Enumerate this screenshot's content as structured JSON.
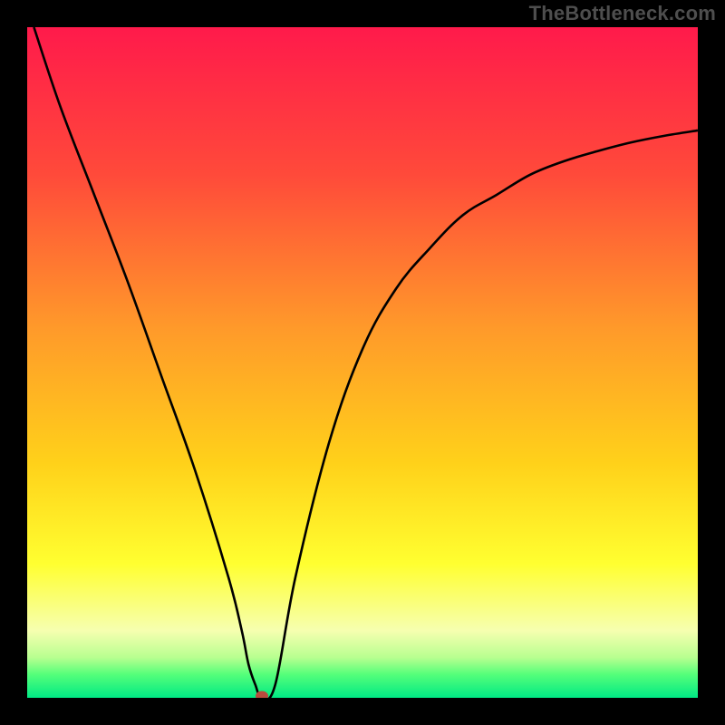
{
  "watermark": "TheBottleneck.com",
  "chart_data": {
    "type": "line",
    "title": "",
    "xlabel": "",
    "ylabel": "",
    "xlim": [
      0,
      100
    ],
    "ylim": [
      0,
      100
    ],
    "grid": false,
    "series": [
      {
        "name": "curve",
        "x": [
          1,
          5,
          10,
          15,
          20,
          25,
          30,
          32,
          33,
          34,
          35,
          37,
          40,
          45,
          50,
          55,
          60,
          65,
          70,
          75,
          80,
          85,
          90,
          95,
          100
        ],
        "y": [
          100,
          88,
          75,
          62,
          48,
          34,
          18,
          10,
          5,
          2,
          0,
          2,
          18,
          38,
          52,
          61,
          67,
          72,
          75,
          78,
          80,
          81.5,
          82.8,
          83.8,
          84.6
        ]
      }
    ],
    "marker": {
      "x": 35,
      "y": 0,
      "color": "#b94a3e"
    },
    "gradient_stops": [
      {
        "offset": 0.0,
        "color": "#ff1a4b"
      },
      {
        "offset": 0.22,
        "color": "#ff4a3a"
      },
      {
        "offset": 0.45,
        "color": "#ff9a2a"
      },
      {
        "offset": 0.65,
        "color": "#ffd11a"
      },
      {
        "offset": 0.8,
        "color": "#ffff30"
      },
      {
        "offset": 0.9,
        "color": "#f6ffb0"
      },
      {
        "offset": 0.94,
        "color": "#b8ff90"
      },
      {
        "offset": 0.965,
        "color": "#55ff7a"
      },
      {
        "offset": 1.0,
        "color": "#00e984"
      }
    ]
  }
}
